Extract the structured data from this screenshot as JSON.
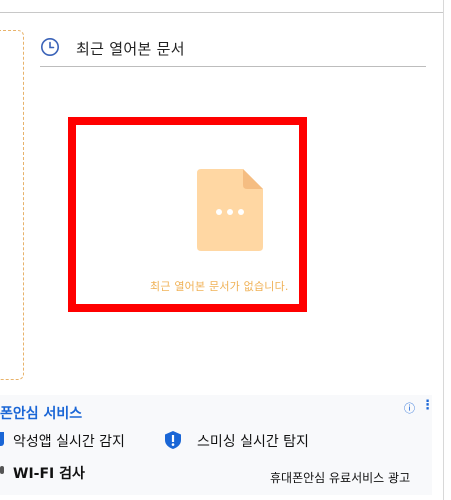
{
  "recent": {
    "title": "최근 열어본 문서",
    "empty_message": "최근 열어본 문서가 없습니다."
  },
  "ad": {
    "title": "폰안심 서비스",
    "info_symbol": "ⓘ",
    "more_symbol": "⋮",
    "items": [
      "악성앱 실시간 감지",
      "스미싱 실시간 탐지",
      "WI-FI 검사"
    ],
    "footer": "휴대폰안심 유료서비스 광고"
  },
  "colors": {
    "highlight": "#ff0000",
    "accent_blue": "#1a66d6",
    "doc_icon": "#ffd7a3",
    "empty_text": "#f0b257",
    "dashed_border": "#e8b26a"
  }
}
